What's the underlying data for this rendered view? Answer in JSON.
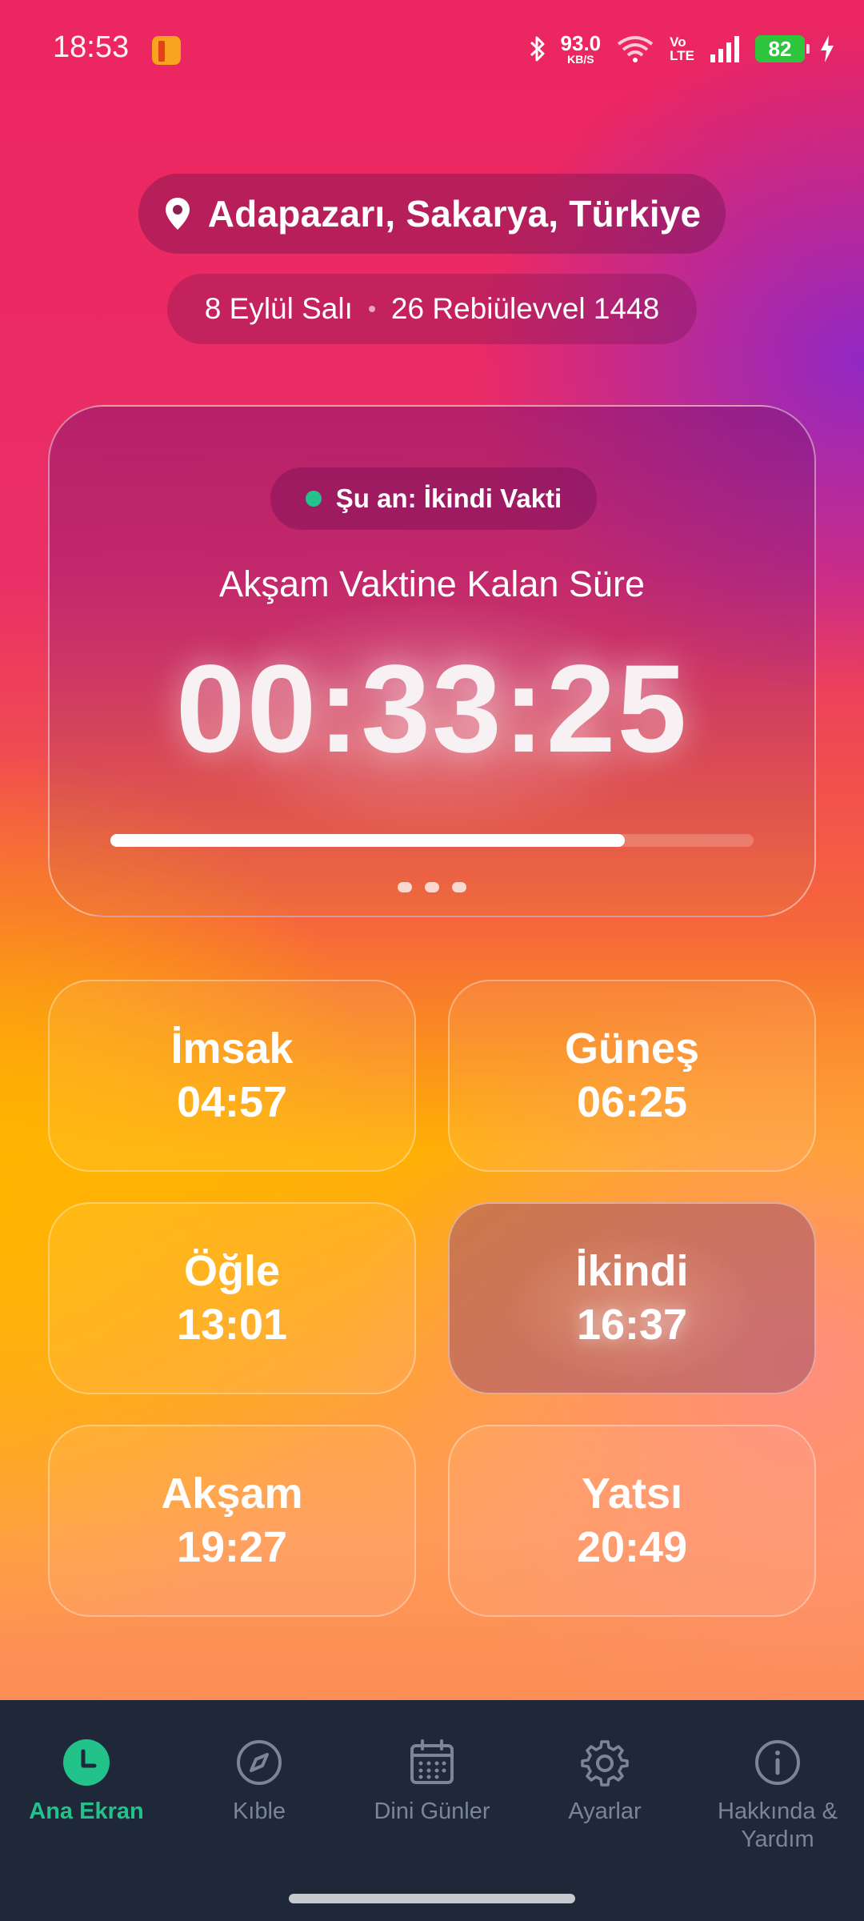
{
  "status_bar": {
    "time": "18:53",
    "net_speed_value": "93.0",
    "net_speed_unit": "KB/S",
    "volte_top": "Vo",
    "volte_bottom": "LTE",
    "battery": "82"
  },
  "header": {
    "location": "Adapazarı, Sakarya, Türkiye",
    "gregorian_date": "8 Eylül Salı",
    "hijri_date": "26 Rebiülevvel 1448"
  },
  "timer_card": {
    "current_label": "Şu an: İkindi Vakti",
    "countdown_label": "Akşam Vaktine Kalan Süre",
    "countdown": "00:33:25",
    "progress_percent": 80,
    "pager_dots": 3
  },
  "prayers": [
    {
      "name": "İmsak",
      "time": "04:57",
      "active": false
    },
    {
      "name": "Güneş",
      "time": "06:25",
      "active": false
    },
    {
      "name": "Öğle",
      "time": "13:01",
      "active": false
    },
    {
      "name": "İkindi",
      "time": "16:37",
      "active": true
    },
    {
      "name": "Akşam",
      "time": "19:27",
      "active": false
    },
    {
      "name": "Yatsı",
      "time": "20:49",
      "active": false
    }
  ],
  "nav": [
    {
      "label": "Ana Ekran",
      "icon": "clock-icon",
      "active": true
    },
    {
      "label": "Kıble",
      "icon": "compass-icon",
      "active": false
    },
    {
      "label": "Dini Günler",
      "icon": "calendar-icon",
      "active": false
    },
    {
      "label": "Ayarlar",
      "icon": "gear-icon",
      "active": false
    },
    {
      "label": "Hakkında & Yardım",
      "icon": "info-icon",
      "active": false
    }
  ],
  "colors": {
    "accent_green": "#23c28b",
    "nav_background": "#1e2838",
    "battery_green": "#2ec43b"
  }
}
